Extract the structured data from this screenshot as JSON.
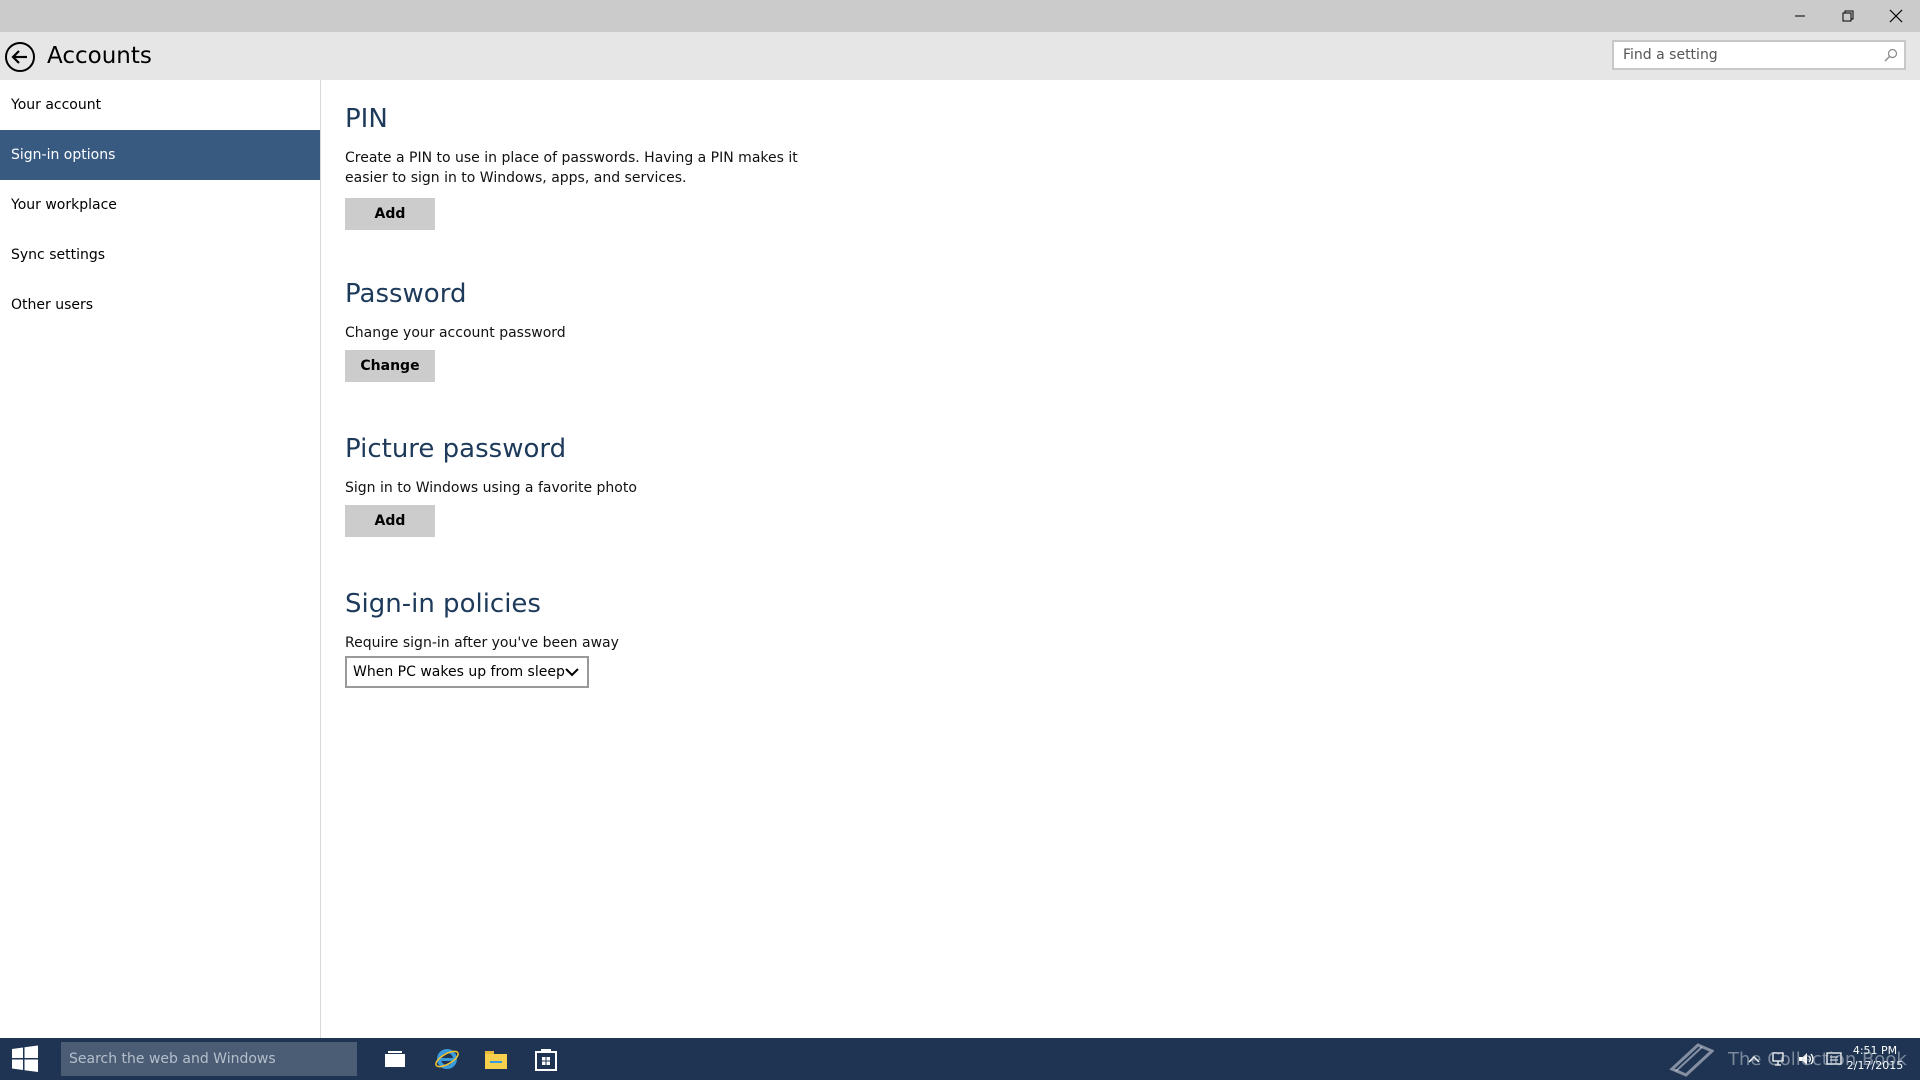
{
  "window": {
    "minimize_icon": "minimize-icon",
    "maximize_icon": "restore-icon",
    "close_icon": "close-icon"
  },
  "header": {
    "back_icon": "back-arrow-icon",
    "title": "Accounts",
    "search_placeholder": "Find a setting",
    "search_value": ""
  },
  "sidebar": {
    "items": [
      {
        "label": "Your account",
        "selected": false
      },
      {
        "label": "Sign-in options",
        "selected": true
      },
      {
        "label": "Your workplace",
        "selected": false
      },
      {
        "label": "Sync settings",
        "selected": false
      },
      {
        "label": "Other users",
        "selected": false
      }
    ]
  },
  "main": {
    "pin": {
      "title": "PIN",
      "description": "Create a PIN to use in place of passwords. Having a PIN makes it easier to sign in to Windows, apps, and services.",
      "button": "Add"
    },
    "password": {
      "title": "Password",
      "description": "Change your account password",
      "button": "Change"
    },
    "picture_password": {
      "title": "Picture password",
      "description": "Sign in to Windows using a favorite photo",
      "button": "Add"
    },
    "sign_in_policies": {
      "title": "Sign-in policies",
      "label": "Require sign-in after you've been away",
      "selected_option": "When PC wakes up from sleep"
    }
  },
  "taskbar": {
    "search_placeholder": "Search the web and Windows",
    "clock_time": "4:51 PM",
    "clock_date": "2/17/2015",
    "watermark": "The Collection Book"
  },
  "colors": {
    "accent": "#385a81",
    "heading": "#1d3a5b",
    "taskbar": "#1e3452"
  }
}
